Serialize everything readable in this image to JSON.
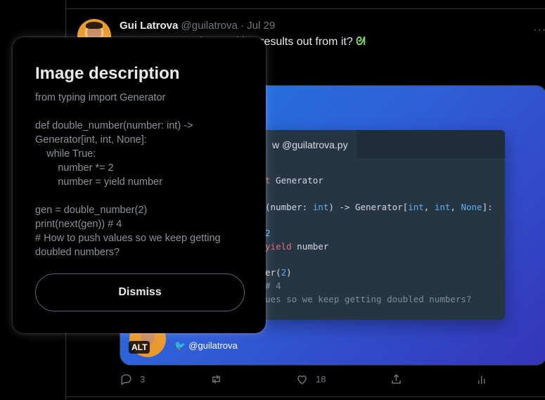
{
  "tweet": {
    "author_name": "Gui Latrova",
    "author_handle": "@guilatrova",
    "date": "Jul 29",
    "text": "ator so you can keep taking results out from it? ",
    "emoji": "ᘛ",
    "media": {
      "tab_label": "w @guilatrova.py",
      "code_lines": [
        {
          "kind": "import",
          "a": "t",
          "b": " Generator"
        },
        {
          "kind": "sig",
          "a": "(number: ",
          "b": "int",
          ") -> ": "",
          "c": ") -> Generator[",
          "d": "int",
          ",_": "",
          "e": ", ",
          "f": "int",
          "g": ", ",
          "h": "None",
          "i": "]:"
        },
        {
          "kind": "num",
          "a": "2"
        },
        {
          "kind": "yield",
          "a": "yield",
          "b": " number"
        },
        {
          "kind": "call",
          "a": "er(",
          "b": "2",
          "c": ")"
        },
        {
          "kind": "comment",
          "a": "# 4"
        },
        {
          "kind": "comment2",
          "a": "ues so we keep getting doubled numbers?"
        }
      ],
      "footer_handle": "@guilatrova",
      "alt_badge": "ALT"
    },
    "actions": {
      "reply_count": "3",
      "like_count": "18"
    }
  },
  "overlay": {
    "title": "Image description",
    "lines": [
      "from typing import Generator",
      "",
      "def double_number(number: int) ->",
      "Generator[int, int, None]:",
      "    while True:",
      "        number *= 2",
      "        number = yield number",
      "",
      "gen = double_number(2)",
      "print(next(gen)) # 4",
      "# How to push values so we keep getting",
      "doubled numbers?"
    ],
    "dismiss_label": "Dismiss"
  },
  "colors": {
    "background": "#000000",
    "text": "#e7e9ea",
    "muted": "#71767b",
    "accent": "#1d9bf0"
  }
}
